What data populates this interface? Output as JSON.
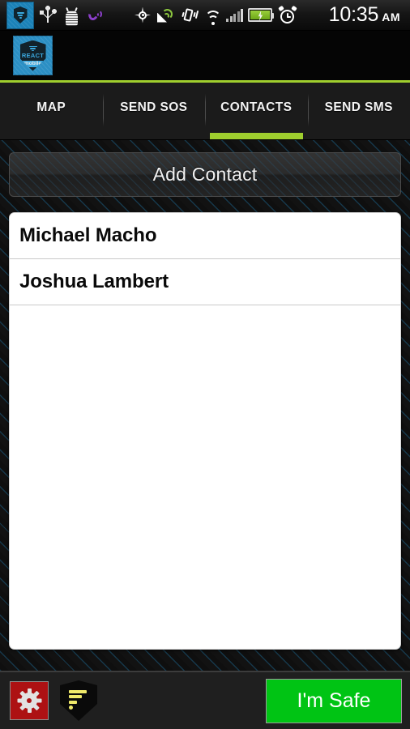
{
  "status_bar": {
    "icons": [
      {
        "name": "app-notification-icon",
        "label": "React Mobile"
      },
      {
        "name": "usb-icon",
        "label": "USB connected"
      },
      {
        "name": "android-debug-icon",
        "label": "USB debugging"
      },
      {
        "name": "viber-call-icon",
        "label": "Viber"
      },
      {
        "name": "gps-crosshair-icon",
        "label": "GPS active"
      },
      {
        "name": "location-broadcast-icon",
        "label": "Location sending"
      },
      {
        "name": "vibrate-icon",
        "label": "Vibrate mode"
      },
      {
        "name": "wifi-icon",
        "label": "Wi-Fi connected"
      },
      {
        "name": "signal-bars-icon",
        "label": "Cellular signal"
      },
      {
        "name": "battery-charging-icon",
        "label": "Battery charging"
      },
      {
        "name": "alarm-clock-icon",
        "label": "Alarm set"
      }
    ],
    "time": "10:35",
    "meridiem": "AM"
  },
  "header": {
    "logo_icon": "react-mobile-logo-icon",
    "logo_brand": "REACT",
    "logo_sub": "mobile",
    "accent_color": "#9fce2e"
  },
  "tabs": [
    {
      "label": "MAP",
      "name": "tab-map",
      "active": false
    },
    {
      "label": "SEND SOS",
      "name": "tab-send-sos",
      "active": false
    },
    {
      "label": "CONTACTS",
      "name": "tab-contacts",
      "active": true
    },
    {
      "label": "SEND SMS",
      "name": "tab-send-sms",
      "active": false
    }
  ],
  "main": {
    "add_contact_label": "Add Contact",
    "contacts": [
      {
        "name": "Michael Macho"
      },
      {
        "name": "Joshua Lambert"
      }
    ]
  },
  "bottom_bar": {
    "settings_icon": "gear-icon",
    "settings_color": "#ad1113",
    "beacon_icon": "shield-wifi-icon",
    "beacon_color": "#efe96a",
    "safe_label": "I'm Safe",
    "safe_color": "#00c414"
  }
}
